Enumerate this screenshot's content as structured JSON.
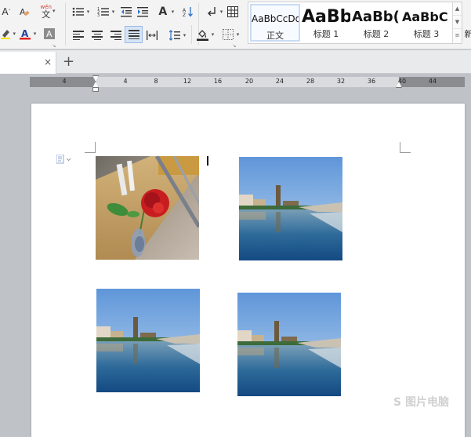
{
  "ribbon": {
    "styles": [
      {
        "sample": "AaBbCcDd",
        "name": "正文",
        "selected": true
      },
      {
        "sample": "AaBb",
        "name": "标题 1",
        "selected": false
      },
      {
        "sample": "AaBb(",
        "name": "标题 2",
        "selected": false
      },
      {
        "sample": "AaBbC",
        "name": "标题 3",
        "selected": false
      }
    ],
    "font_a_label": "A",
    "pinyin_label": "wén",
    "pinyin_sub": "文",
    "cut_label": "新"
  },
  "tab": {
    "new_tab_symbol": "+",
    "close_symbol": "×"
  },
  "ruler": {
    "ticks": [
      "4",
      "",
      "4",
      "8",
      "12",
      "16",
      "20",
      "24",
      "28",
      "32",
      "36",
      "40",
      "44"
    ]
  },
  "watermark": "S 图片电脑"
}
